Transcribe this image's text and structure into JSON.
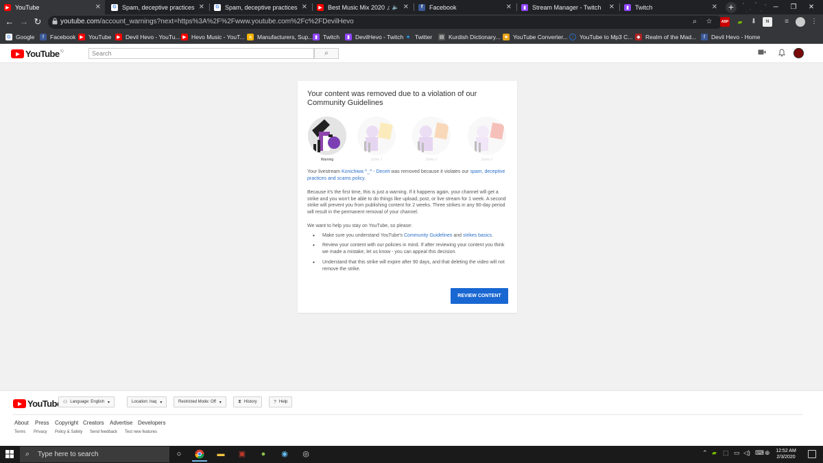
{
  "browser": {
    "tabs": [
      {
        "title": "YouTube",
        "favicon": "youtube-icon",
        "color": "#ff0000",
        "active": true
      },
      {
        "title": "Spam, deceptive practices & scams",
        "favicon": "google-icon",
        "color": "#4285f4",
        "active": false
      },
      {
        "title": "Spam, deceptive practices & scams",
        "favicon": "google-icon",
        "color": "#4285f4",
        "active": false
      },
      {
        "title": "Best Music Mix 2020 ♫ EDM",
        "favicon": "youtube-icon",
        "color": "#ff0000",
        "active": false
      },
      {
        "title": "Facebook",
        "favicon": "facebook-icon",
        "color": "#3b5998",
        "active": false
      },
      {
        "title": "Stream Manager - Twitch",
        "favicon": "twitch-icon",
        "color": "#9146ff",
        "active": false
      },
      {
        "title": "Twitch",
        "favicon": "twitch-icon",
        "color": "#9146ff",
        "active": false
      }
    ],
    "url_domain": "youtube.com",
    "url_rest": "/account_warnings?next=https%3A%2F%2Fwww.youtube.com%2Fc%2FDevilHevo",
    "abp_label": "ABP",
    "bookmarks": [
      {
        "label": "Google",
        "icon": "google-icon",
        "color": "#4285f4"
      },
      {
        "label": "Facebook",
        "icon": "facebook-icon",
        "color": "#3b5998"
      },
      {
        "label": "YouTube",
        "icon": "youtube-icon",
        "color": "#ff0000"
      },
      {
        "label": "Devil Hevo - YouTu...",
        "icon": "youtube-icon",
        "color": "#ff0000"
      },
      {
        "label": "Hevo Music - YouT...",
        "icon": "youtube-icon",
        "color": "#ff0000"
      },
      {
        "label": "Manufacturers, Sup...",
        "icon": "alibaba-icon",
        "color": "#f5b400"
      },
      {
        "label": "Twitch",
        "icon": "twitch-icon",
        "color": "#9146ff"
      },
      {
        "label": "DevilHevo - Twitch",
        "icon": "twitch-icon",
        "color": "#9146ff"
      },
      {
        "label": "Twitter",
        "icon": "twitter-icon",
        "color": "#1da1f2"
      },
      {
        "label": "Kurdish Dictionary...",
        "icon": "dictionary-icon",
        "color": "#666666"
      },
      {
        "label": "YouTube Converter...",
        "icon": "converter-icon",
        "color": "#e8a317"
      },
      {
        "label": "YouTube to Mp3 C...",
        "icon": "download-icon",
        "color": "#2a6fc9"
      },
      {
        "label": "Realm of the Mad...",
        "icon": "game-icon",
        "color": "#b22222"
      },
      {
        "label": "Devil Hevo - Home",
        "icon": "facebook-icon",
        "color": "#3b5998"
      }
    ]
  },
  "youtube": {
    "logo_text": "YouTube",
    "country_code": "IQ",
    "search_placeholder": "Search"
  },
  "card": {
    "title": "Your content was removed due to a violation of our Community Guidelines",
    "strikes": [
      {
        "label": "Warning",
        "active": true,
        "accent": "#8e44ad"
      },
      {
        "label": "Strike 1",
        "active": false,
        "accent": "#f5c842"
      },
      {
        "label": "Strike 2",
        "active": false,
        "accent": "#f0923a"
      },
      {
        "label": "Strike 3",
        "active": false,
        "accent": "#e74c3c"
      }
    ],
    "p1_before": "Your livestream ",
    "p1_link1": "Konichiwa ^_^ - Deceit",
    "p1_middle": " was removed because it violates our ",
    "p1_link2": "spam, deceptive practices and scams policy",
    "p1_after": ".",
    "p2": "Because it's the first time, this is just a warning. If it happens again, your channel will get a strike and you won't be able to do things like upload, post, or live stream for 1 week. A second strike will prevent you from publishing content for 2 weeks. Three strikes in any 90-day period will result in the permanent removal of your channel.",
    "p3": "We want to help you stay on YouTube, so please:",
    "li1_before": "Make sure you understand YouTube's ",
    "li1_link1": "Community Guidelines",
    "li1_middle": " and ",
    "li1_link2": "strikes basics",
    "li1_after": ".",
    "li2": "Review your content with our policies in mind. If after reviewing your content you think we made a mistake, let us know - you can appeal this decision.",
    "li3": "Understand that this strike will expire after 90 days, and that deleting the video will not remove the strike.",
    "button": "REVIEW CONTENT"
  },
  "footer": {
    "logo_text": "YouTube",
    "language": "Language: English",
    "location": "Location: Iraq",
    "restricted": "Restricted Mode: Off",
    "history": "History",
    "help": "Help",
    "links": [
      "About",
      "Press",
      "Copyright",
      "Creators",
      "Advertise",
      "Developers"
    ],
    "links2": [
      "Terms",
      "Privacy",
      "Policy & Safety",
      "Send feedback",
      "Test new features"
    ]
  },
  "taskbar": {
    "search_placeholder": "Type here to search",
    "time": "12:52 AM",
    "date": "2/3/2020"
  }
}
